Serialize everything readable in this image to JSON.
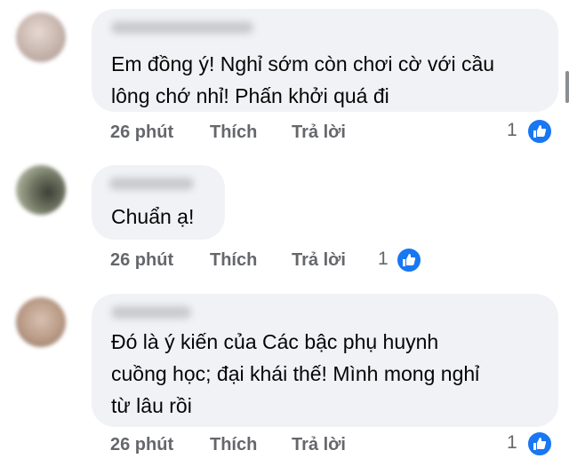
{
  "comments": [
    {
      "text_lines": [
        "Em đồng ý! Nghỉ sớm còn chơi cờ với cầu",
        "lông chớ nhỉ! Phấn khởi quá đi"
      ],
      "time": "26 phút",
      "like_label": "Thích",
      "reply_label": "Trả lời",
      "reaction_count": "1",
      "avatar_color": "#c6b4ac"
    },
    {
      "text_lines": [
        "Chuẩn ạ!"
      ],
      "time": "26 phút",
      "like_label": "Thích",
      "reply_label": "Trả lời",
      "reaction_count": "1",
      "avatar_color": "#8a8f78"
    },
    {
      "text_lines": [
        "Đó là ý kiến của Các bậc phụ huynh",
        "cuồng học; đại khái thế! Mình mong nghỉ",
        "từ lâu rồi"
      ],
      "time": "26 phút",
      "like_label": "Thích",
      "reply_label": "Trả lời",
      "reaction_count": "1",
      "avatar_color": "#b99a86"
    }
  ],
  "colors": {
    "bubble": "#f0f2f5",
    "action_text": "#65676b",
    "like_blue": "#1877f2"
  },
  "icons": [
    "like-thumb-icon"
  ]
}
